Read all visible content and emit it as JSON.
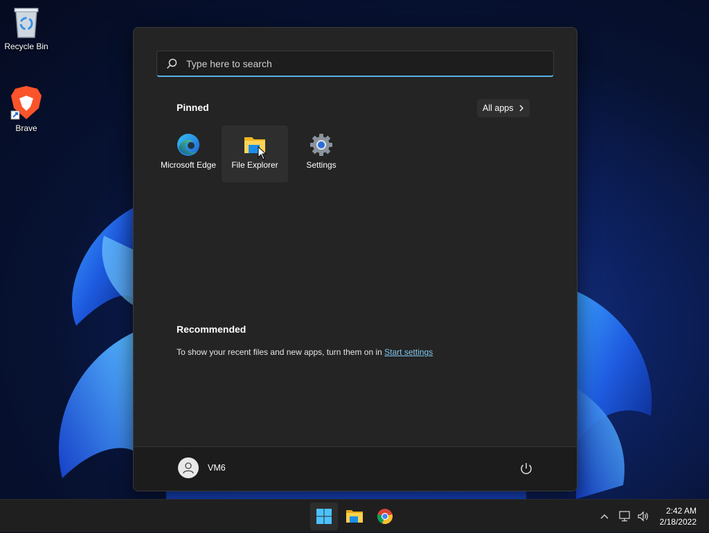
{
  "desktop": {
    "icons": [
      {
        "label": "Recycle Bin",
        "icon": "recycle-bin-icon"
      },
      {
        "label": "Brave",
        "icon": "brave-lion-icon"
      }
    ]
  },
  "start_menu": {
    "search": {
      "placeholder": "Type here to search"
    },
    "pinned": {
      "title": "Pinned",
      "all_apps_label": "All apps",
      "apps": [
        {
          "label": "Microsoft Edge",
          "icon": "edge-icon"
        },
        {
          "label": "File Explorer",
          "icon": "folder-icon"
        },
        {
          "label": "Settings",
          "icon": "gear-icon"
        }
      ]
    },
    "recommended": {
      "title": "Recommended",
      "text": "To show your recent files and new apps, turn them on in ",
      "link": "Start settings"
    },
    "user": {
      "name": "VM6"
    }
  },
  "taskbar": {
    "apps": [
      "windows-start-icon",
      "folder-icon",
      "chrome-icon"
    ],
    "clock": {
      "time": "2:42 AM",
      "date": "2/18/2022"
    }
  },
  "colors": {
    "accent": "#5ab3e8",
    "menu_bg": "#242424",
    "taskbar_bg": "#1f1f1f",
    "link": "#7fc6ee"
  }
}
